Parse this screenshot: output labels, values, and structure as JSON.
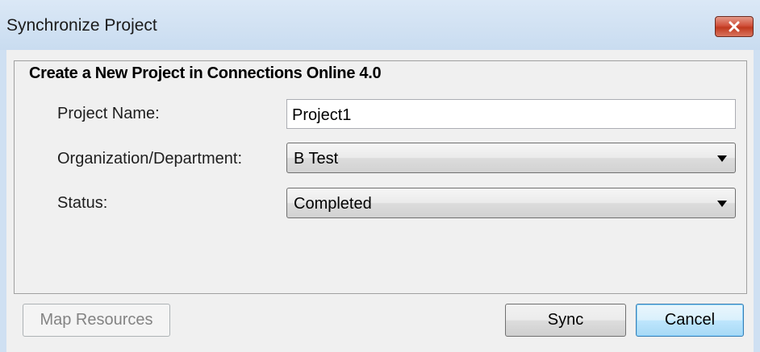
{
  "window": {
    "title": "Synchronize Project"
  },
  "form": {
    "header": "Create a New Project in Connections Online 4.0",
    "project_name_label": "Project Name:",
    "project_name_value": "Project1",
    "organization_label": "Organization/Department:",
    "organization_value": "B Test",
    "status_label": "Status:",
    "status_value": "Completed"
  },
  "buttons": {
    "map_resources": "Map Resources",
    "sync": "Sync",
    "cancel": "Cancel"
  },
  "icons": {
    "close": "close-icon",
    "dropdown": "chevron-down-icon"
  },
  "colors": {
    "title_bar": "#cfe0f2",
    "close_button": "#c7432b",
    "dialog_background": "#f0f0f0",
    "default_button_border": "#3c7fb1"
  }
}
